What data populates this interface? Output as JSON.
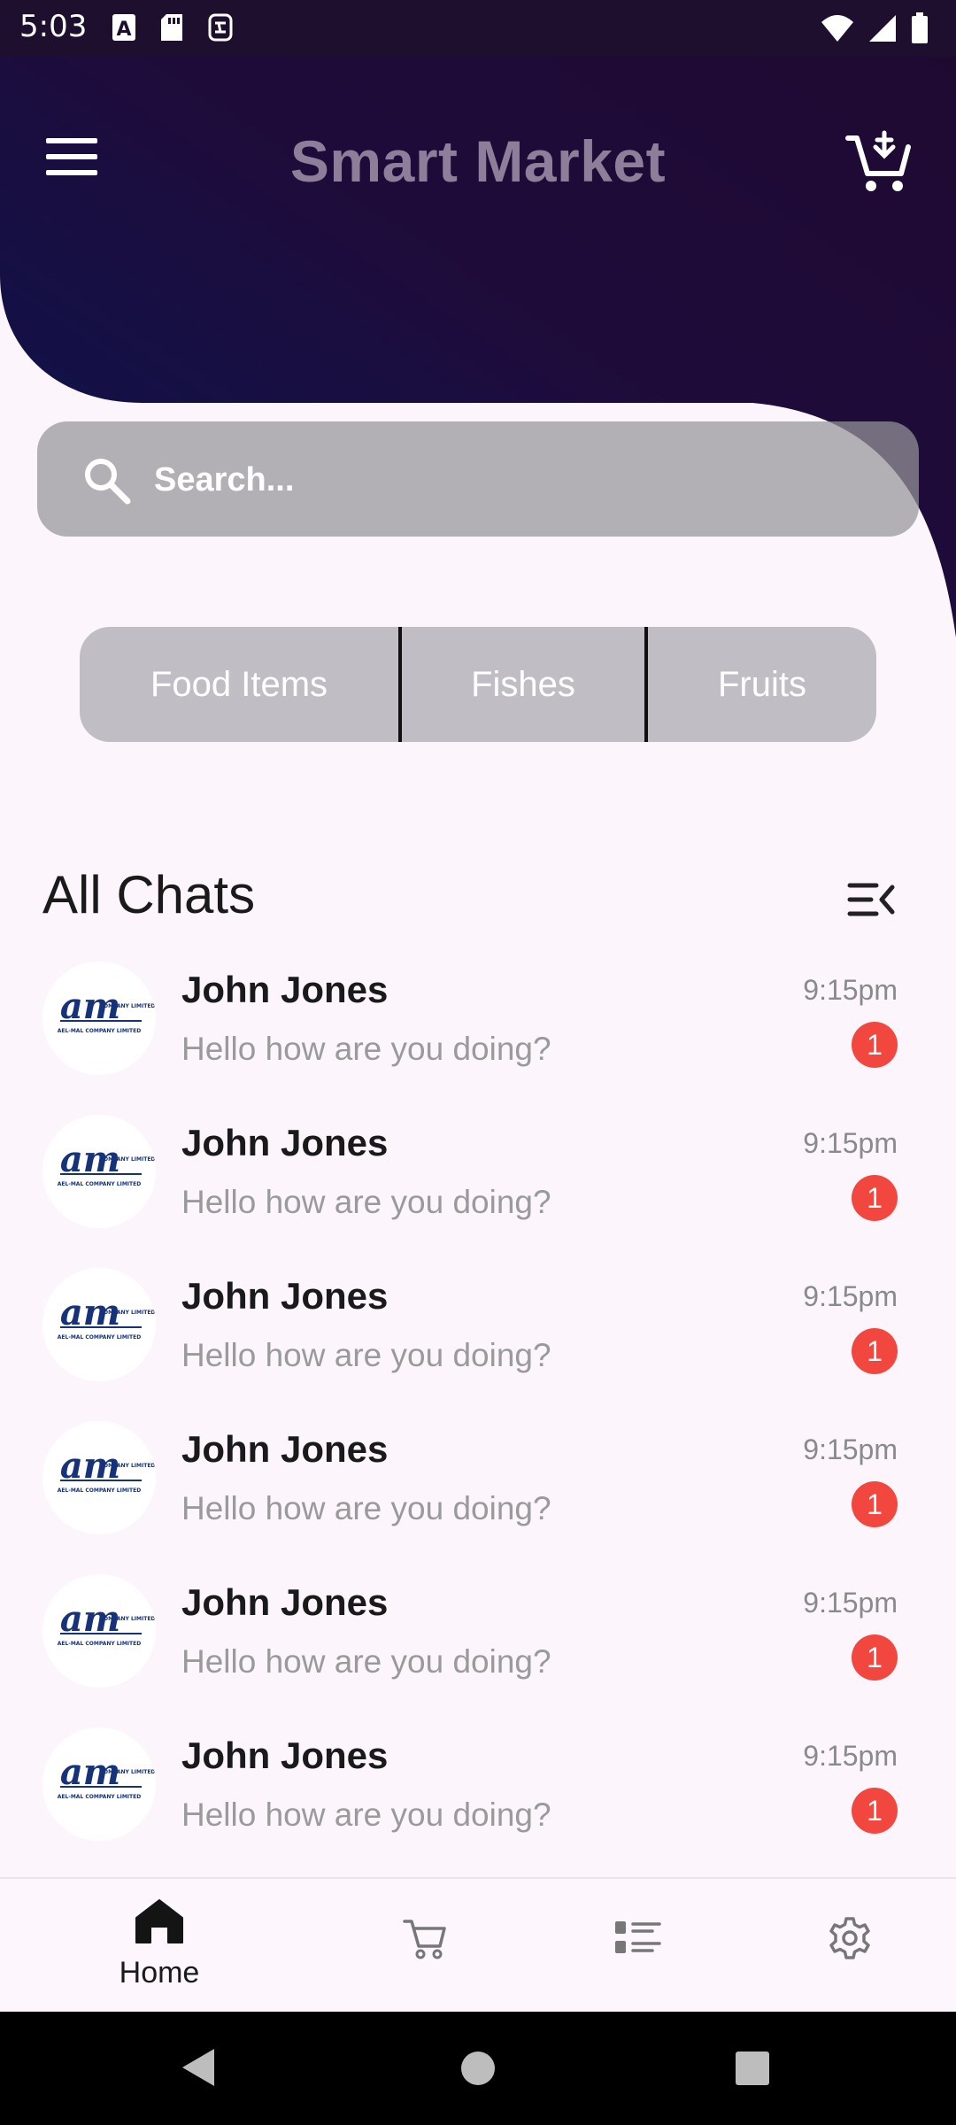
{
  "status_bar": {
    "time": "5:03"
  },
  "header": {
    "title": "Smart Market",
    "menu_icon": "menu-icon",
    "cart_icon": "add-shopping-cart-icon",
    "gradient_colors": [
      "#0a1550",
      "#1e0a33"
    ]
  },
  "search": {
    "placeholder": "Search..."
  },
  "categories": [
    {
      "label": "Food Items"
    },
    {
      "label": "Fishes"
    },
    {
      "label": "Fruits"
    }
  ],
  "chats": {
    "title": "All Chats",
    "items": [
      {
        "name": "John Jones",
        "message": "Hello how are you doing?",
        "time": "9:15pm",
        "unread": "1"
      },
      {
        "name": "John Jones",
        "message": "Hello how are you doing?",
        "time": "9:15pm",
        "unread": "1"
      },
      {
        "name": "John Jones",
        "message": "Hello how are you doing?",
        "time": "9:15pm",
        "unread": "1"
      },
      {
        "name": "John Jones",
        "message": "Hello how are you doing?",
        "time": "9:15pm",
        "unread": "1"
      },
      {
        "name": "John Jones",
        "message": "Hello how are you doing?",
        "time": "9:15pm",
        "unread": "1"
      },
      {
        "name": "John Jones",
        "message": "Hello how are you doing?",
        "time": "9:15pm",
        "unread": "1"
      }
    ],
    "avatar_logo_text": "am",
    "avatar_logo_subtext": "AEL-MAL COMPANY LIMITED",
    "avatar_logo_tag": "COMPANY LIMITED"
  },
  "bottom_nav": {
    "home_label": "Home",
    "active": "home",
    "icons": [
      "home-icon",
      "cart-icon",
      "list-icon",
      "settings-icon"
    ]
  },
  "colors": {
    "badge": "#f2473f",
    "title": "#8e7e99"
  }
}
